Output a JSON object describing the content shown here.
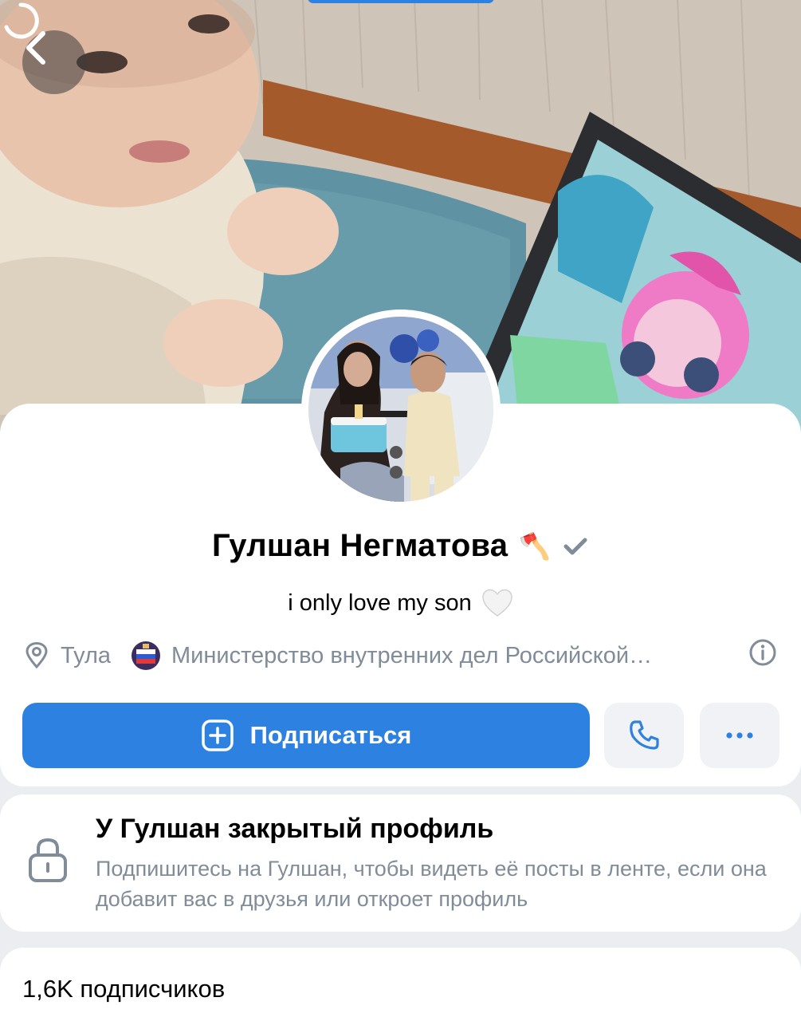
{
  "profile": {
    "name": "Гулшан Негматова",
    "status_emoji": "🪓",
    "bio": "i only love my son",
    "bio_emoji": "🤍",
    "location": "Тула",
    "organization": "Министерство внутренних дел Российской…"
  },
  "actions": {
    "subscribe_label": "Подписаться",
    "call_icon": "phone-icon",
    "more_icon": "more-icon"
  },
  "closed_profile": {
    "title": "У Гулшан закрытый профиль",
    "description": "Подпишитесь на Гулшан, чтобы видеть её посты в ленте, если она добавит вас в друзья или откроет профиль"
  },
  "followers": {
    "label": "1,6K подписчиков"
  },
  "colors": {
    "accent": "#2d81e0",
    "secondary_text": "#818c99",
    "background": "#ebedf0",
    "card": "#ffffff"
  }
}
